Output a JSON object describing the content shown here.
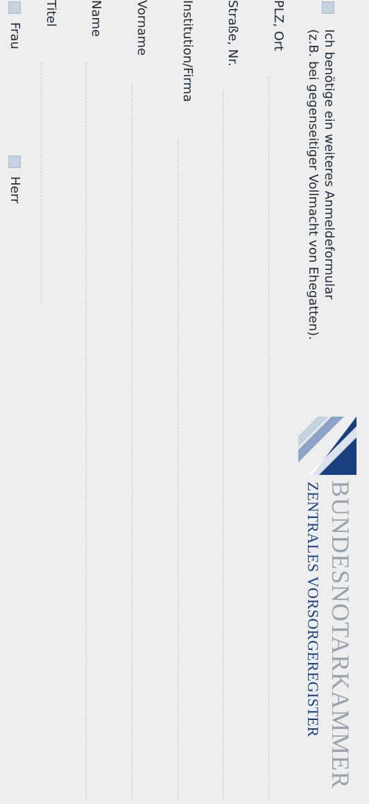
{
  "form": {
    "salutation_options": [
      {
        "label": "Frau",
        "checked": false
      },
      {
        "label": "Herr",
        "checked": false
      }
    ],
    "fields": [
      {
        "label": "Titel"
      },
      {
        "label": "Name"
      },
      {
        "label": "Vorname"
      },
      {
        "label": "Institution/Firma"
      },
      {
        "label": "Straße, Nr."
      },
      {
        "label": "PLZ, Ort"
      }
    ],
    "extra_form_checkbox": {
      "checked": false,
      "line1": "Ich benötige ein weiteres Anmeldeformular",
      "line2": "(z.B. bei gegenseitiger Vollmacht von Ehegatten)."
    }
  },
  "brand": {
    "line1": "BUNDESNOTARKAMMER",
    "line2": "ZENTRALES VORSORGEREGISTER",
    "colors": {
      "logo_dark": "#1a3f7f",
      "logo_light": "#8fa3c9",
      "line1": "#9aa3ac",
      "line2": "#1a3f7f"
    }
  },
  "colors": {
    "background": "#eeeeee",
    "checkbox_fill": "#c5d3e1",
    "dashed_line": "#c7c7c7",
    "text": "#1e2a35"
  }
}
